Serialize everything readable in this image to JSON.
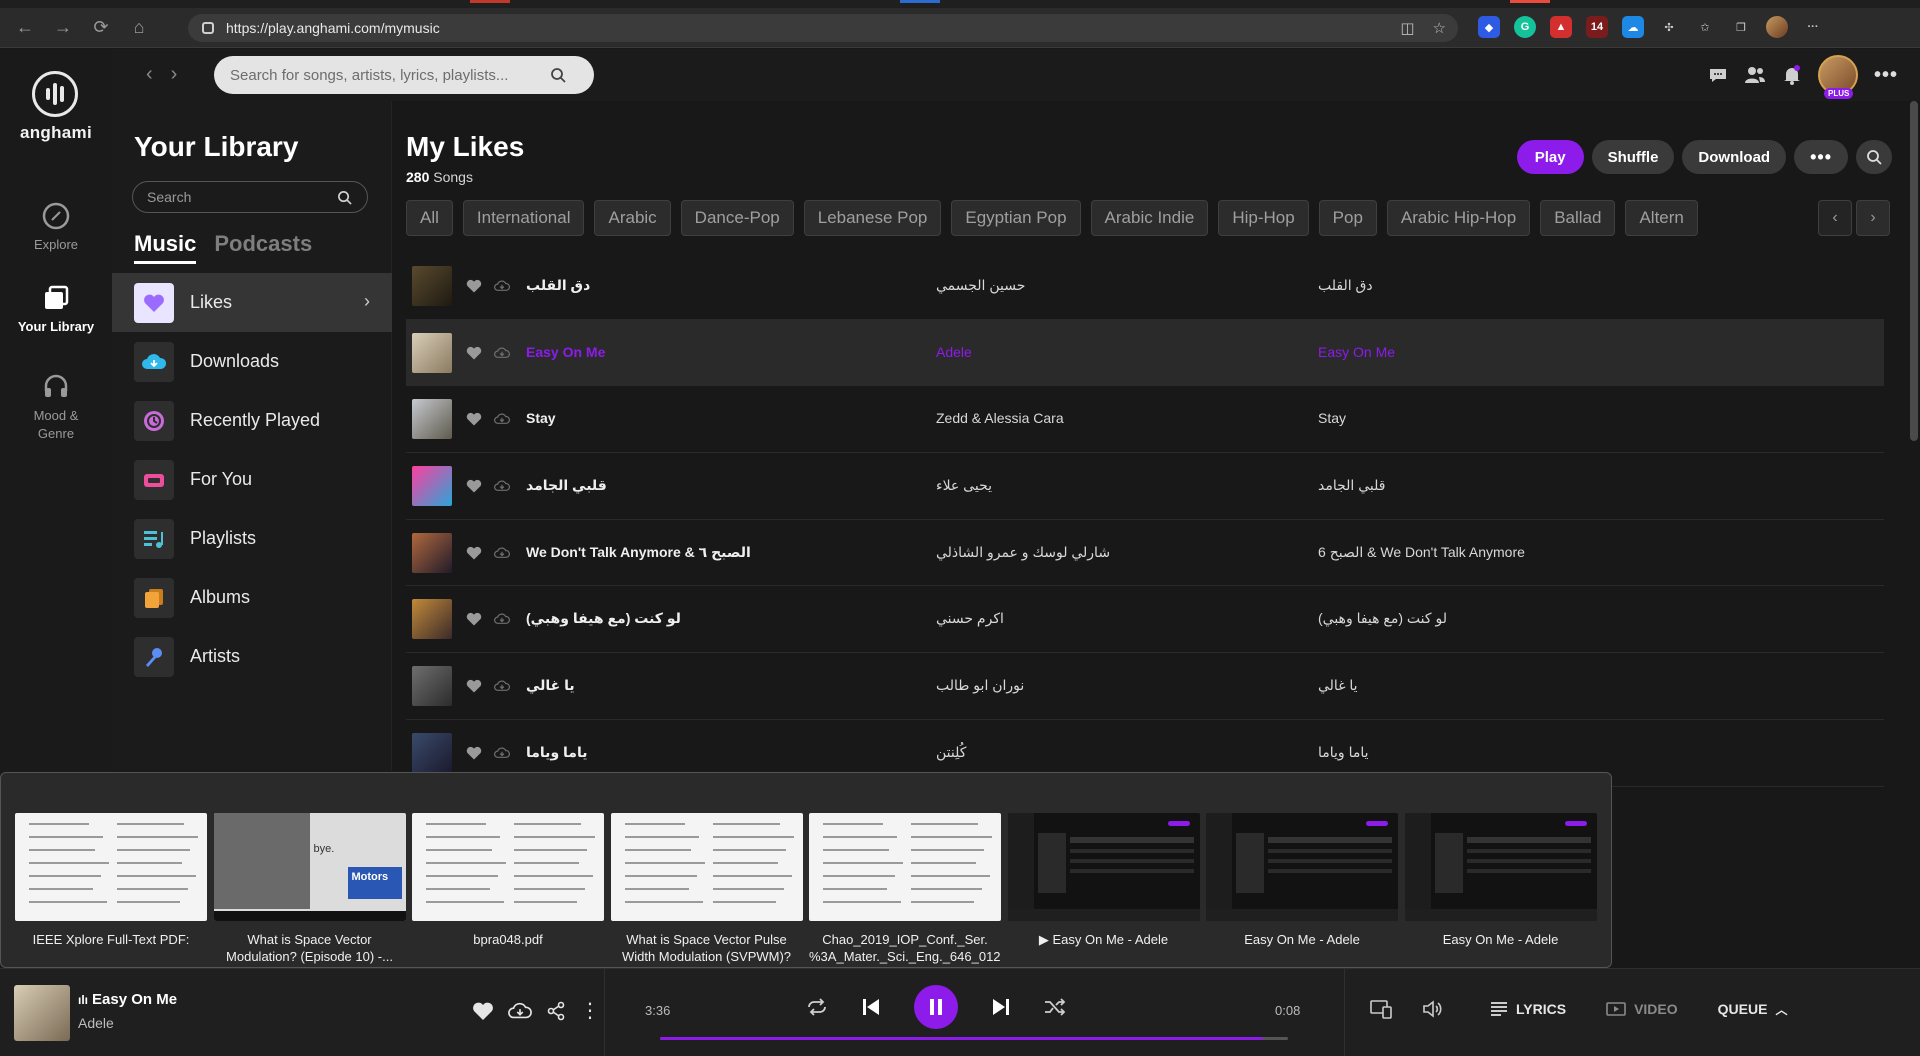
{
  "browser": {
    "url": "https://play.anghami.com/mymusic",
    "extension_badge": "14"
  },
  "app": {
    "logo_text": "anghami",
    "plus_badge": "PLUS",
    "search_placeholder": "Search for songs, artists, lyrics, playlists...",
    "accent": "#8d1bea"
  },
  "rail": [
    {
      "label": "Explore",
      "icon": "compass-icon"
    },
    {
      "label": "Your Library",
      "icon": "library-icon",
      "active": true
    },
    {
      "label": "Mood & Genre",
      "icon": "headphones-icon"
    }
  ],
  "library": {
    "title": "Your Library",
    "search_placeholder": "Search",
    "tabs": [
      "Music",
      "Podcasts"
    ],
    "items": [
      {
        "label": "Likes",
        "icon": "heart-icon",
        "color": "#9b6bff"
      },
      {
        "label": "Downloads",
        "icon": "cloud-download-icon",
        "color": "#2fb8ec"
      },
      {
        "label": "Recently Played",
        "icon": "history-icon",
        "color": "#c96ad9"
      },
      {
        "label": "For You",
        "icon": "radio-icon",
        "color": "#ee4d9b"
      },
      {
        "label": "Playlists",
        "icon": "playlist-icon",
        "color": "#4fc1d6"
      },
      {
        "label": "Albums",
        "icon": "albums-icon",
        "color": "#f2a33a"
      },
      {
        "label": "Artists",
        "icon": "microphone-icon",
        "color": "#5b8df5"
      }
    ]
  },
  "playlist": {
    "title": "My Likes",
    "count": "280",
    "count_label": "Songs",
    "actions": {
      "play": "Play",
      "shuffle": "Shuffle",
      "download": "Download"
    },
    "chips": [
      "All",
      "International",
      "Arabic",
      "Dance-Pop",
      "Lebanese Pop",
      "Egyptian Pop",
      "Arabic Indie",
      "Hip-Hop",
      "Pop",
      "Arabic Hip-Hop",
      "Ballad",
      "Altern"
    ],
    "tracks": [
      {
        "name": "دق القلب",
        "artist": "حسين الجسمي",
        "album": "دق القلب",
        "art": [
          "#5a4a2e",
          "#1e1a12"
        ]
      },
      {
        "name": "Easy On Me",
        "artist": "Adele",
        "album": "Easy On Me",
        "art": [
          "#d9cfb8",
          "#8a7a60"
        ],
        "playing": true
      },
      {
        "name": "Stay",
        "artist": "Zedd & Alessia Cara",
        "album": "Stay",
        "art": [
          "#c5c9cf",
          "#5f5a4d"
        ]
      },
      {
        "name": "قلبي الجامد",
        "artist": "يحيى علاء",
        "album": "قلبي الجامد",
        "art": [
          "#ff3f9e",
          "#2aa5d8"
        ]
      },
      {
        "name": "We Don't Talk Anymore & الصبح ٦",
        "artist": "شارلي لوسك و عمرو الشاذلي",
        "album": "6 الصبح & We Don't Talk Anymore",
        "art": [
          "#b0683e",
          "#221b2a"
        ]
      },
      {
        "name": "لو كنت (مع هيفا وهبي)",
        "artist": "اكرم حسني",
        "album": "لو كنت (مع هيفا وهبي)",
        "art": [
          "#c28a3a",
          "#3b2a2a"
        ]
      },
      {
        "name": "يا غالي",
        "artist": "نوران ابو طالب",
        "album": "يا غالي",
        "art": [
          "#6e6e6e",
          "#2c2c2c"
        ]
      },
      {
        "name": "ياما وياما",
        "artist": "كُلِنتن",
        "album": "ياما وياما",
        "art": [
          "#3a4a6a",
          "#1a1a2e"
        ]
      }
    ]
  },
  "taskbar_thumbnails": [
    {
      "label": "IEEE Xplore Full-Text PDF:",
      "style": "doc"
    },
    {
      "label": "What is Space Vector Modulation? (Episode 10) -...",
      "style": "video"
    },
    {
      "label": "bpra048.pdf",
      "style": "doc"
    },
    {
      "label": "What is Space Vector Pulse Width Modulation (SVPWM)?",
      "style": "doc"
    },
    {
      "label": "Chao_2019_IOP_Conf._Ser. %3A_Mater._Sci._Eng._646_012...",
      "style": "doc"
    },
    {
      "label": "▶ Easy On Me - Adele",
      "style": "dark"
    },
    {
      "label": "Easy On Me - Adele",
      "style": "dark"
    },
    {
      "label": "Easy On Me - Adele",
      "style": "dark"
    }
  ],
  "video_thumb_text": {
    "title": "Motors",
    "word": "bye."
  },
  "player": {
    "title": "Easy On Me",
    "artist": "Adele",
    "elapsed": "3:36",
    "remaining": "0:08",
    "progress": 0.96,
    "lyrics": "LYRICS",
    "video": "VIDEO",
    "queue": "QUEUE"
  }
}
